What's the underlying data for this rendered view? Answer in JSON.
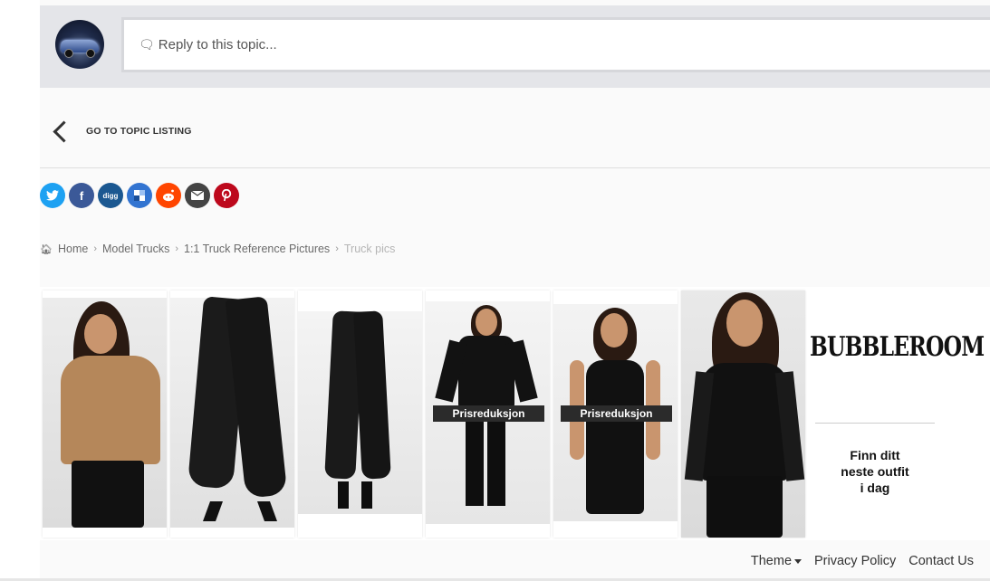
{
  "reply": {
    "placeholder": "Reply to this topic..."
  },
  "navigation": {
    "go_to_listing": "GO TO TOPIC LISTING"
  },
  "share": {
    "buttons": [
      {
        "name": "twitter",
        "glyph": "t",
        "color": "#1da1f2"
      },
      {
        "name": "facebook",
        "glyph": "f",
        "color": "#3b5998"
      },
      {
        "name": "digg",
        "glyph": "digg",
        "color": "#1b5891"
      },
      {
        "name": "delicious",
        "glyph": "d",
        "color": "#3274d1"
      },
      {
        "name": "reddit",
        "glyph": "r",
        "color": "#ff4500"
      },
      {
        "name": "email",
        "glyph": "✉",
        "color": "#444444"
      },
      {
        "name": "pinterest",
        "glyph": "p",
        "color": "#bd081c"
      }
    ]
  },
  "breadcrumb": {
    "items": [
      "Home",
      "Model Trucks",
      "1:1 Truck Reference Pictures"
    ],
    "current": "Truck pics"
  },
  "ad": {
    "products": [
      {
        "name": "wrap-top-model",
        "badge": ""
      },
      {
        "name": "leather-pants-front",
        "badge": ""
      },
      {
        "name": "leather-pants-back",
        "badge": ""
      },
      {
        "name": "black-blouse-model",
        "badge": "Prisreduksjon"
      },
      {
        "name": "black-dress-model",
        "badge": "Prisreduksjon"
      },
      {
        "name": "lace-top-model",
        "badge": ""
      }
    ],
    "brand": "BUBBLEROOM",
    "cta": "Finn ditt neste outfit i dag"
  },
  "footer": {
    "theme": "Theme",
    "privacy": "Privacy Policy",
    "contact": "Contact Us"
  }
}
